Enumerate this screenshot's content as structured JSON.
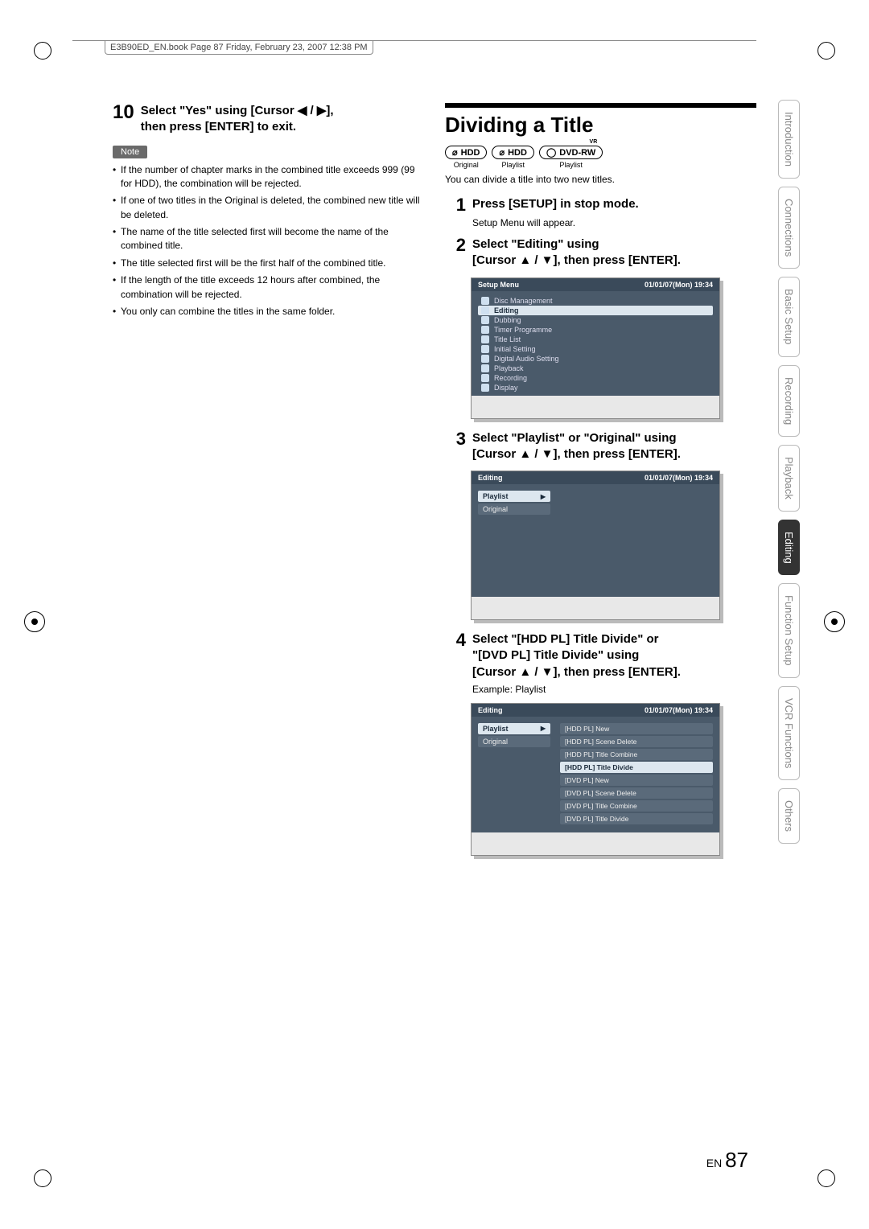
{
  "header": {
    "book_info": "E3B90ED_EN.book  Page 87  Friday, February 23, 2007  12:38 PM"
  },
  "left": {
    "step10_num": "10",
    "step10_text_a": "Select \"Yes\" using [Cursor ◀ / ▶],",
    "step10_text_b": "then press [ENTER] to exit.",
    "note_label": "Note",
    "bullets": [
      "If the number of chapter marks in the combined title exceeds 999 (99 for HDD), the combination will be rejected.",
      "If one of two titles in the Original is deleted, the combined new title will be deleted.",
      "The name of the title selected first will become the name of the combined title.",
      "The title selected first will be the first half of the combined title.",
      "If the length of the title exceeds 12 hours after combined, the combination will be rejected.",
      "You only can combine the titles in the same folder."
    ]
  },
  "right": {
    "h2": "Dividing a Title",
    "badges": [
      {
        "label": "HDD",
        "sub": "Original"
      },
      {
        "label": "HDD",
        "sub": "Playlist"
      },
      {
        "label": "DVD-RW",
        "sup": "VR",
        "sub": "Playlist"
      }
    ],
    "desc": "You can divide a title into two new titles.",
    "step1_num": "1",
    "step1_text": "Press [SETUP] in stop mode.",
    "step1_sub": "Setup Menu will appear.",
    "step2_num": "2",
    "step2_text_a": "Select \"Editing\" using",
    "step2_text_b": "[Cursor ▲ / ▼], then press [ENTER].",
    "shot1": {
      "title": "Setup Menu",
      "time": "01/01/07(Mon)   19:34",
      "items": [
        "Disc Management",
        "Editing",
        "Dubbing",
        "Timer Programme",
        "Title List",
        "Initial Setting",
        "Digital Audio Setting",
        "Playback",
        "Recording",
        "Display"
      ],
      "selected": "Editing"
    },
    "step3_num": "3",
    "step3_text_a": "Select \"Playlist\" or \"Original\" using",
    "step3_text_b": "[Cursor ▲ / ▼], then press [ENTER].",
    "shot2": {
      "title": "Editing",
      "time": "01/01/07(Mon)   19:34",
      "left_items": [
        "Playlist",
        "Original"
      ],
      "left_selected": "Playlist"
    },
    "step4_num": "4",
    "step4_text_a": "Select \"[HDD PL] Title Divide\" or",
    "step4_text_b": "\"[DVD PL] Title Divide\" using",
    "step4_text_c": "[Cursor ▲ / ▼], then press [ENTER].",
    "step4_sub": "Example: Playlist",
    "shot3": {
      "title": "Editing",
      "time": "01/01/07(Mon)   19:34",
      "left_items": [
        "Playlist",
        "Original"
      ],
      "left_selected": "Playlist",
      "sub_items": [
        "[HDD PL] New",
        "[HDD PL] Scene Delete",
        "[HDD PL] Title Combine",
        "[HDD PL] Title Divide",
        "[DVD PL] New",
        "[DVD PL] Scene Delete",
        "[DVD PL] Title Combine",
        "[DVD PL] Title Divide"
      ],
      "sub_selected": "[HDD PL] Title Divide"
    }
  },
  "tabs": [
    "Introduction",
    "Connections",
    "Basic Setup",
    "Recording",
    "Playback",
    "Editing",
    "Function Setup",
    "VCR Functions",
    "Others"
  ],
  "tab_active": "Editing",
  "footer": {
    "en": "EN",
    "page": "87"
  }
}
